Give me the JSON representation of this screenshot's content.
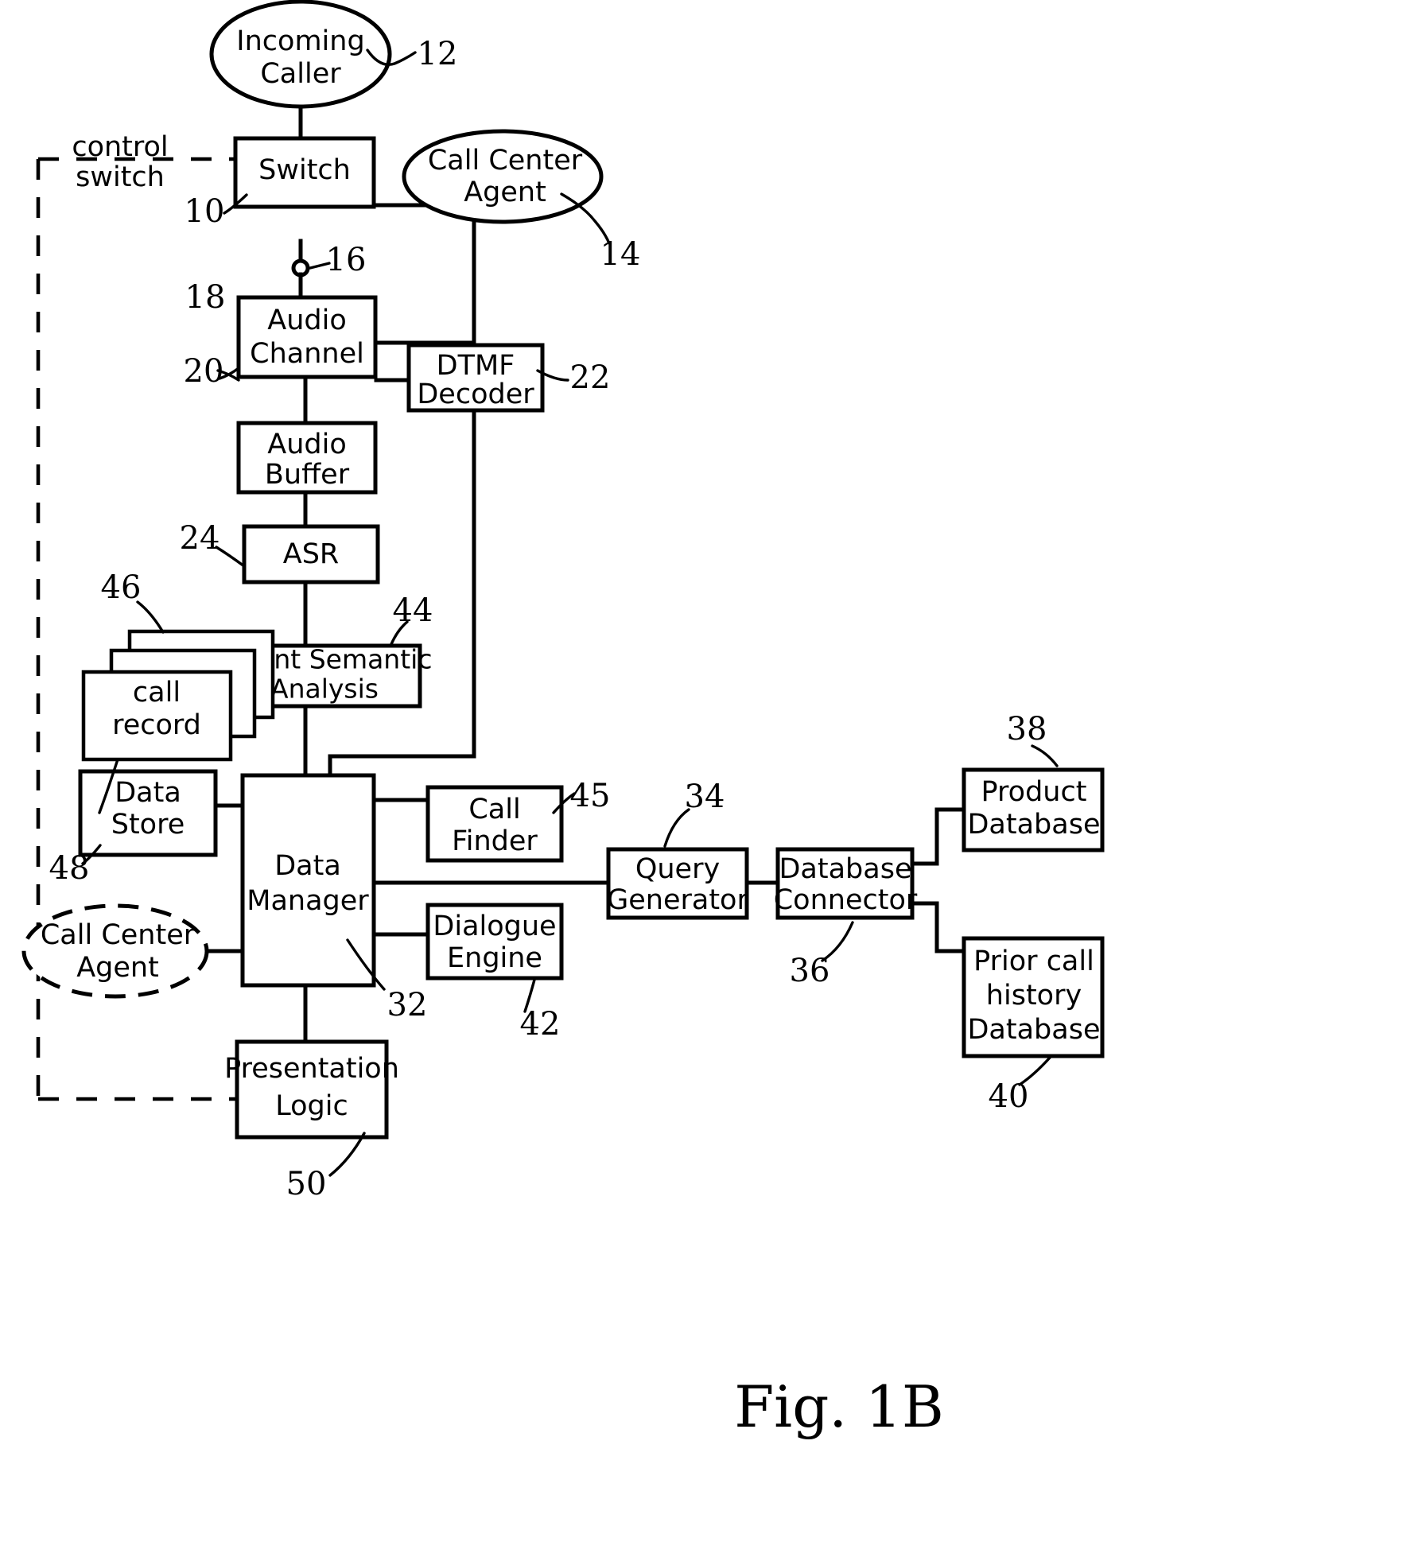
{
  "figure": {
    "caption": "Fig. 1B",
    "boundary_label_line1": "control",
    "boundary_label_line2": "switch"
  },
  "nodes": {
    "incoming_caller": {
      "line1": "Incoming",
      "line2": "Caller",
      "ref": "12"
    },
    "switch": {
      "line1": "Switch",
      "ref": "10"
    },
    "call_center_agent_top": {
      "line1": "Call Center",
      "line2": "Agent",
      "ref": "14"
    },
    "tap_point": {
      "ref": "16"
    },
    "audio_channel": {
      "line1": "Audio",
      "line2": "Channel",
      "ref": "18"
    },
    "audio_buffer": {
      "line1": "Audio",
      "line2": "Buffer",
      "ref": "20"
    },
    "dtmf_decoder": {
      "line1": "DTMF",
      "line2": "Decoder",
      "ref": "22"
    },
    "asr": {
      "line1": "ASR",
      "ref": "24"
    },
    "latent_semantic_analysis": {
      "line1": "Latent Semantic",
      "line2": "Analysis",
      "ref": "44"
    },
    "call_record": {
      "line1": "call",
      "line2": "record",
      "ref": "46"
    },
    "data_store": {
      "line1": "Data",
      "line2": "Store",
      "ref": "48"
    },
    "data_manager": {
      "line1": "Data",
      "line2": "Manager",
      "ref": "32"
    },
    "call_finder": {
      "line1": "Call",
      "line2": "Finder",
      "ref": "45"
    },
    "dialogue_engine": {
      "line1": "Dialogue",
      "line2": "Engine",
      "ref": "42"
    },
    "call_center_agent_bottom": {
      "line1": "Call Center",
      "line2": "Agent"
    },
    "presentation_logic": {
      "line1": "Presentation",
      "line2": "Logic",
      "ref": "50"
    },
    "query_generator": {
      "line1": "Query",
      "line2": "Generator",
      "ref": "34"
    },
    "database_connector": {
      "line1": "Database",
      "line2": "Connector",
      "ref": "36"
    },
    "product_database": {
      "line1": "Product",
      "line2": "Database",
      "ref": "38"
    },
    "prior_call_history_database": {
      "line1": "Prior call",
      "line2": "history",
      "line3": "Database",
      "ref": "40"
    }
  },
  "colors": {
    "ink": "#000000",
    "paper": "#ffffff"
  }
}
